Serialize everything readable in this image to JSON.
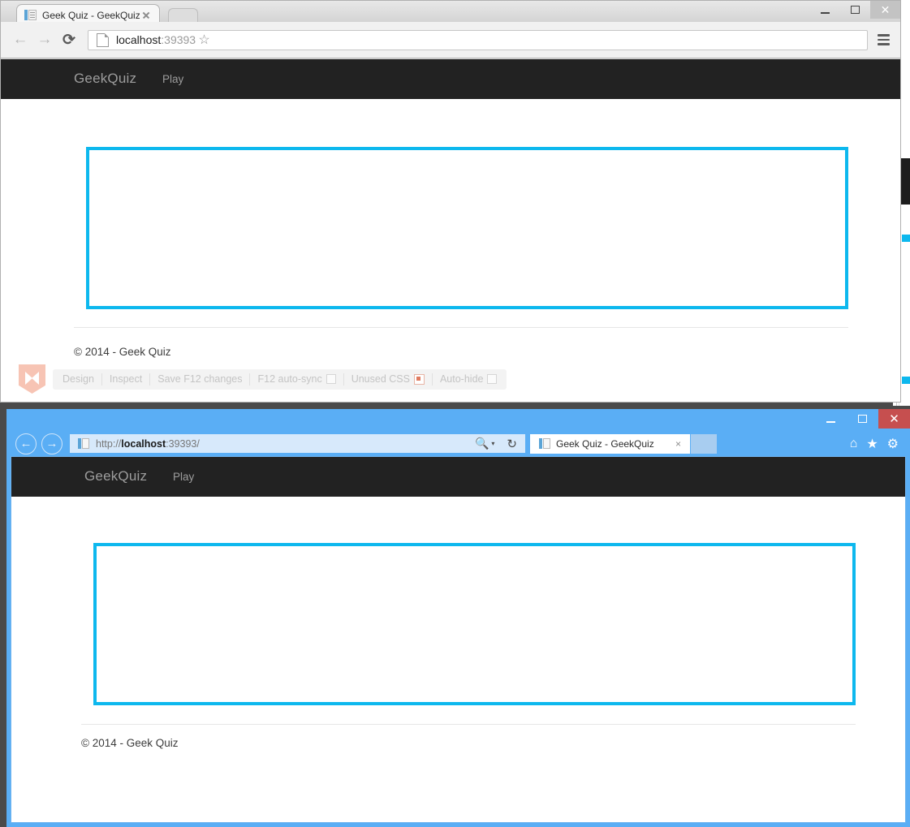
{
  "chrome_window": {
    "tab": {
      "title": "Geek Quiz - GeekQuiz",
      "favicon": "document-icon",
      "close": "×"
    },
    "new_tab_button": "new-tab",
    "window_controls": {
      "minimize": "–",
      "maximize": "☐",
      "close": "✕"
    },
    "toolbar": {
      "back": "←",
      "forward": "→",
      "reload": "⟳",
      "page_icon": "page-icon",
      "url_host": "localhost",
      "url_port": ":39393",
      "star": "☆",
      "menu": "hamburger-menu"
    }
  },
  "page": {
    "navbar": {
      "brand": "GeekQuiz",
      "play_link": "Play"
    },
    "footer": {
      "copyright": "© 2014 - Geek Quiz"
    }
  },
  "browser_link_toolbar": {
    "logo": "visual-studio-logo",
    "items": [
      {
        "label": "Design",
        "control": "none"
      },
      {
        "label": "Inspect",
        "control": "none"
      },
      {
        "label": "Save F12 changes",
        "control": "none"
      },
      {
        "label": "F12 auto-sync",
        "control": "checkbox",
        "checked": false
      },
      {
        "label": "Unused CSS",
        "control": "radio",
        "checked": true
      },
      {
        "label": "Auto-hide",
        "control": "checkbox",
        "checked": false
      }
    ]
  },
  "ie_window": {
    "window_controls": {
      "minimize": "–",
      "maximize": "☐",
      "close": "✕"
    },
    "nav": {
      "back": "←",
      "forward": "→",
      "url_scheme": "http://",
      "url_host": "localhost",
      "url_tail": ":39393/",
      "search_icon": "search-icon",
      "search_caret": "▾",
      "refresh_icon": "↻"
    },
    "tab": {
      "title": "Geek Quiz - GeekQuiz",
      "favicon": "document-icon",
      "close": "×"
    },
    "tools": {
      "home": "⌂",
      "favorites": "★",
      "settings": "⚙"
    }
  },
  "colors": {
    "accent_cyan": "#0db8ee",
    "navbar_dark": "#222222",
    "ie_chrome_blue": "#5aaef5",
    "vs_logo_pink": "#f7c4b4"
  }
}
